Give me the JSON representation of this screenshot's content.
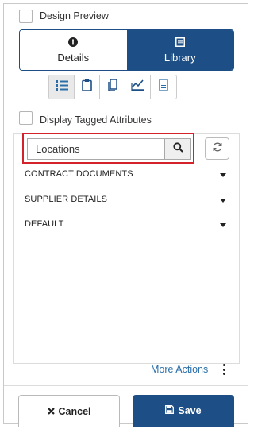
{
  "design_preview": {
    "label": "Design Preview",
    "checked": false
  },
  "view_toggle": {
    "details_label": "Details",
    "library_label": "Library",
    "selected": "Library"
  },
  "toolbar": {
    "icons": [
      "list-icon",
      "clipboard-icon",
      "copy-icon",
      "sign-icon",
      "document-icon"
    ],
    "selected": "list-icon"
  },
  "display_tagged": {
    "label": "Display Tagged Attributes",
    "checked": false
  },
  "search": {
    "value": "Locations",
    "placeholder": ""
  },
  "sections": [
    {
      "label": "CONTRACT DOCUMENTS"
    },
    {
      "label": "SUPPLIER DETAILS"
    },
    {
      "label": "DEFAULT"
    }
  ],
  "more_actions": {
    "label": "More Actions"
  },
  "footer": {
    "cancel_label": "Cancel",
    "save_label": "Save"
  },
  "colors": {
    "primary": "#1d4f86",
    "highlight": "#d3222a",
    "link": "#2a6ea8"
  }
}
